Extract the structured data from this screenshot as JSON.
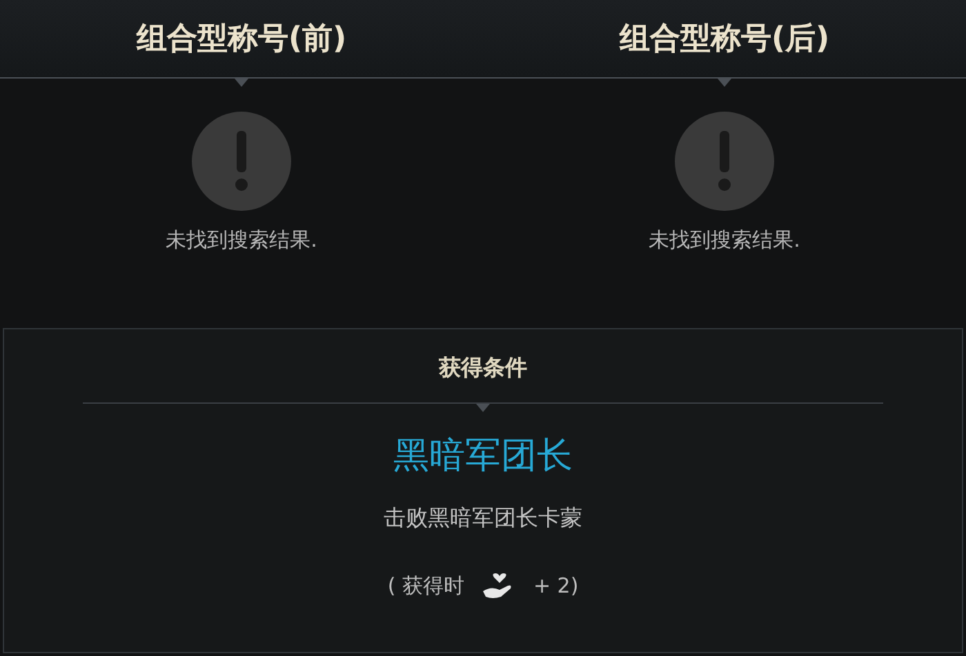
{
  "columns": [
    {
      "title": "组合型称号(前)",
      "message": "未找到搜索结果."
    },
    {
      "title": "组合型称号(后)",
      "message": "未找到搜索结果."
    }
  ],
  "condition": {
    "header": "获得条件",
    "title": "黑暗军团长",
    "description": "击败黑暗军团长卡蒙",
    "reward": {
      "prefix": "( 获得时",
      "suffix": "+ 2)"
    }
  }
}
